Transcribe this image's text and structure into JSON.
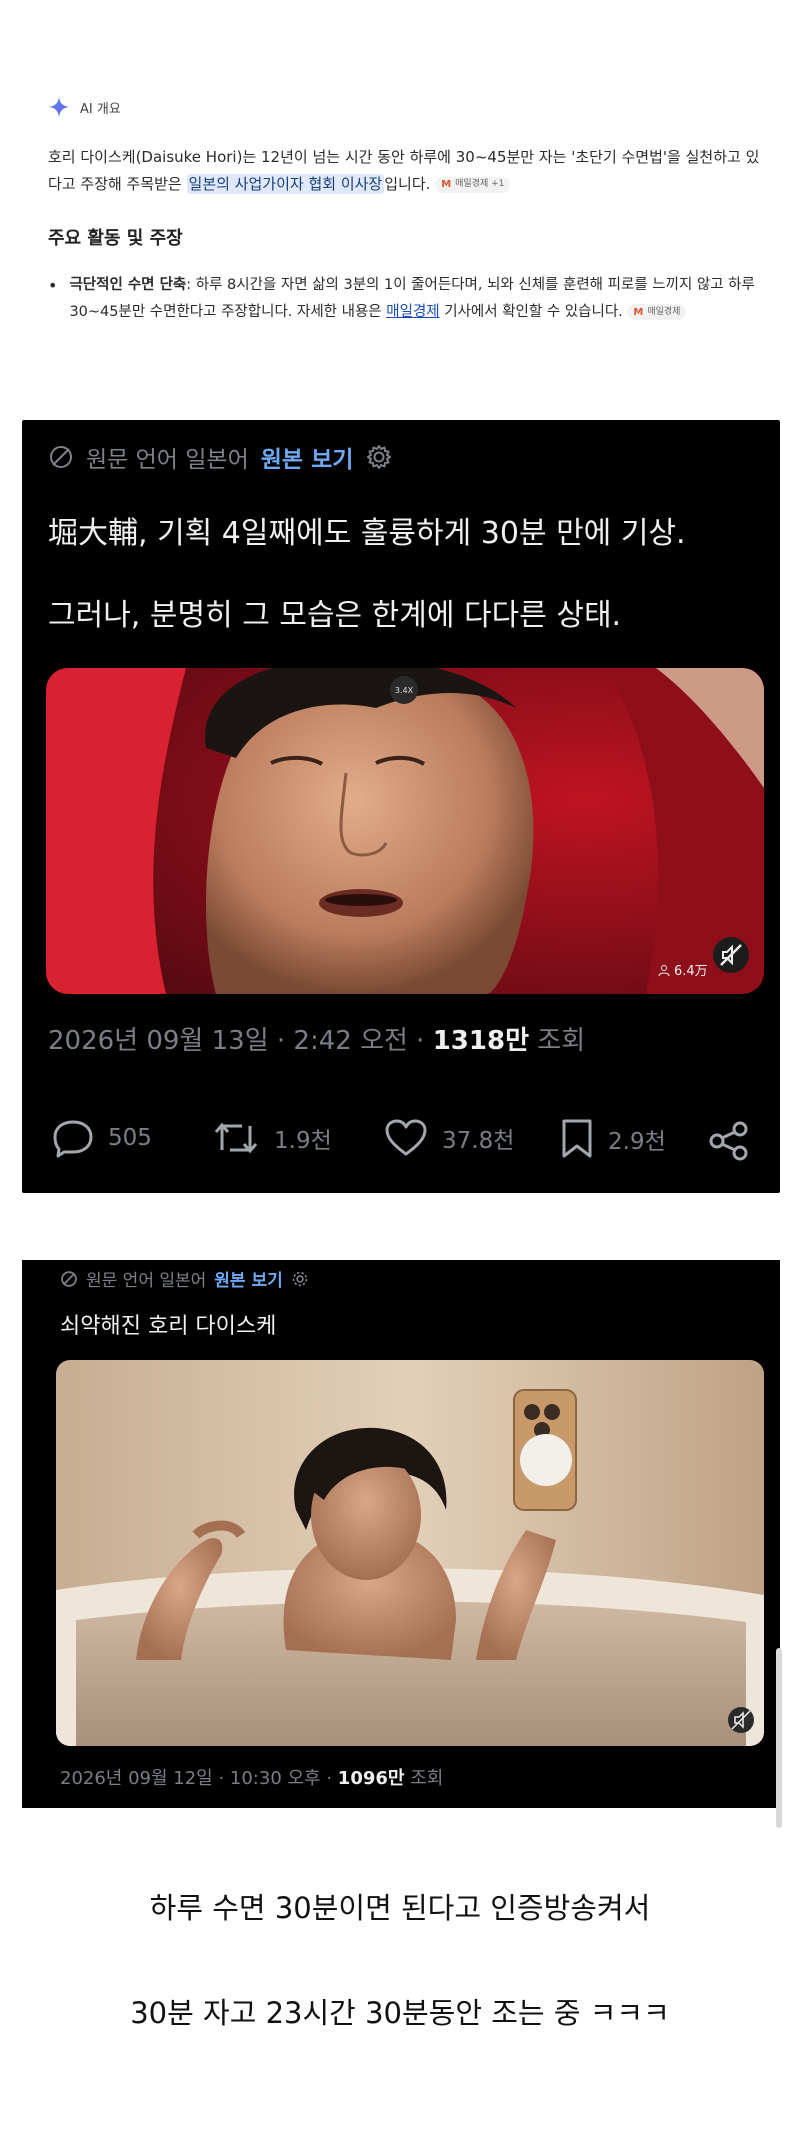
{
  "ai_overview": {
    "label": "AI 개요",
    "summary_pre": "호리 다이스케(Daisuke Hori)는 12년이 넘는 시간 동안 하루에 30~45분만 자는 '초단기 수면법'을 실천하고 있다고 주장해 주목받은 ",
    "summary_highlight": "일본의 사업가이자 협회 이사장",
    "summary_post": "입니다.",
    "summary_source": "매일경제 +1",
    "section_title": "주요 활동 및 주장",
    "bullet_bold": "극단적인 수면 단축",
    "bullet_text": ": 하루 8시간을 자면 삶의 3분의 1이 줄어든다며, 뇌와 신체를 훈련해 피로를 느끼지 않고 하루 30~45분만 수면한다고 주장합니다. 자세한 내용은 ",
    "bullet_link": "매일경제",
    "bullet_tail": " 기사에서 확인할 수 있습니다.",
    "bullet_source": "매일경제"
  },
  "post1": {
    "translate_text": "원문 언어 일본어",
    "translate_link": "원본 보기",
    "line1": "堀大輔, 기획 4일째에도 훌륭하게 30분 만에 기상.",
    "line2": "그러나, 분명히 그 모습은 한계에 다다른 상태.",
    "speed_badge": "3.4X",
    "viewers": "6.4万",
    "date": "2026년 09월 13일 · 2:42 오전 · ",
    "views": "1318만",
    "views_suffix": " 조회",
    "replies": "505",
    "retweets": "1.9천",
    "likes": "37.8천",
    "bookmarks": "2.9천"
  },
  "post2": {
    "translate_text": "원문 언어 일본어",
    "translate_link": "원본 보기",
    "line1": "쇠약해진 호리 다이스케",
    "date": "2026년 09월 12일 · 10:30 오후 · ",
    "views": "1096만",
    "views_suffix": " 조회"
  },
  "caption": {
    "line1": "하루 수면 30분이면 된다고 인증방송켜서",
    "line2": "30분 자고 23시간 30분동안 조는 중 ㅋㅋㅋ"
  },
  "colors": {
    "link_blue": "#6ea9f5",
    "dark_bg": "#000000",
    "muted": "#7a7f85",
    "highlight_bg": "#dfe9fb"
  }
}
